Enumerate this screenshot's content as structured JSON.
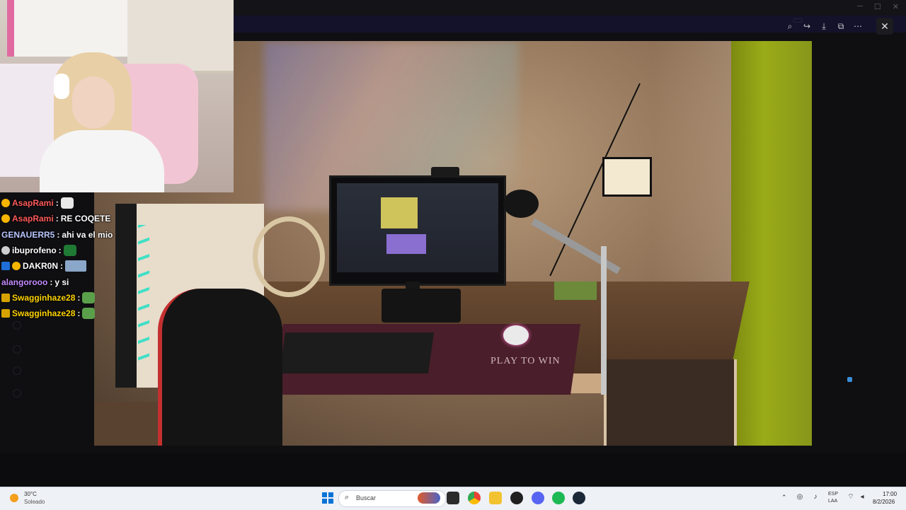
{
  "app": {
    "title": "",
    "banner_text": "",
    "banner_button": ""
  },
  "viewer_toolbar": {
    "zoom_icon": "zoom-icon",
    "forward_icon": "forward-icon",
    "download_icon": "download-icon",
    "open_external_icon": "open-external-icon",
    "more_icon": "more-icon",
    "close_icon": "close-icon"
  },
  "photo": {
    "mousepad_text": "PLAY TO WIN"
  },
  "chat": {
    "messages": [
      {
        "user": "AsapRami",
        "user_color": "#ff5a5a",
        "badges": [
          "gold"
        ],
        "text": "",
        "emote": true
      },
      {
        "user": "AsapRami",
        "user_color": "#ff5a5a",
        "badges": [
          "gold"
        ],
        "text": "RE COQETE",
        "emote": false
      },
      {
        "user": "GENAUERR5",
        "user_color": "#b9c7ff",
        "badges": [],
        "text": "ahi va el mio",
        "emote": false
      },
      {
        "user": "ibuprofeno",
        "user_color": "#ffffff",
        "badges": [
          "grey"
        ],
        "text": "",
        "emote": true
      },
      {
        "user": "DAKR0N",
        "user_color": "#ffffff",
        "badges": [
          "prime",
          "gold"
        ],
        "text": "",
        "emote": true
      },
      {
        "user": "alangorooo",
        "user_color": "#c58bff",
        "badges": [],
        "text": "y si",
        "emote": false
      },
      {
        "user": "Swagginhaze28",
        "user_color": "#ffd400",
        "badges": [
          "sub"
        ],
        "text": "",
        "emote": true
      },
      {
        "user": "Swagginhaze28",
        "user_color": "#ffd400",
        "badges": [
          "sub"
        ],
        "text": "",
        "emote": true
      }
    ]
  },
  "taskbar": {
    "weather_temp": "30°C",
    "weather_desc": "Soleado",
    "search_placeholder": "Buscar",
    "lang_top": "ESP",
    "lang_bottom": "LAA",
    "time": "17:00",
    "date": "8/2/2026",
    "apps": [
      "task-view",
      "chrome",
      "file-explorer",
      "obs",
      "discord",
      "spotify",
      "steam"
    ]
  },
  "colors": {
    "accent": "#0a74d6",
    "taskbar_bg": "#eef1f6"
  }
}
